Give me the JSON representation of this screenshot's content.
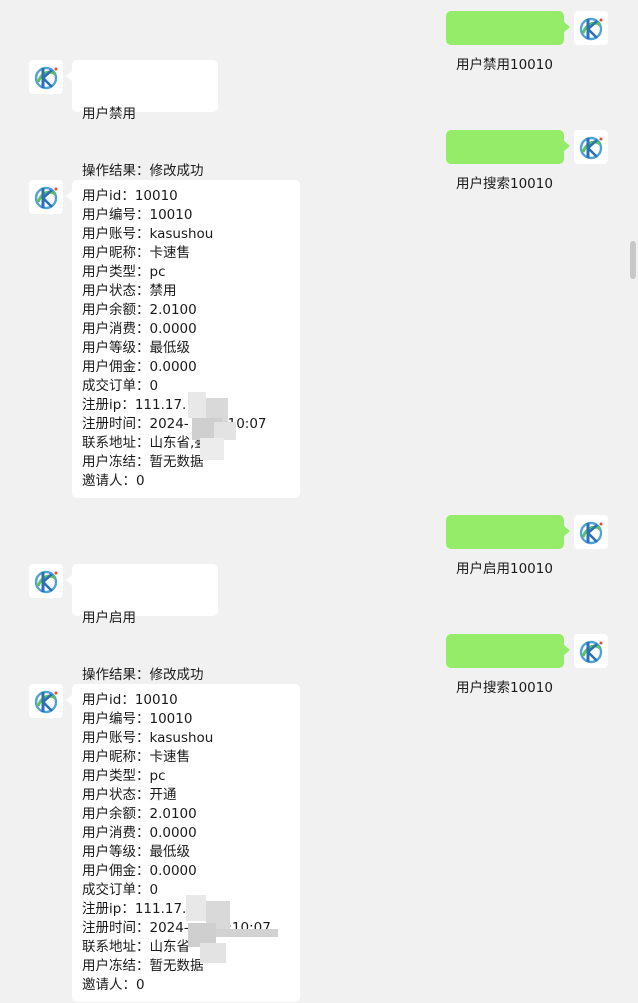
{
  "colors": {
    "background": "#f1f1f1",
    "sent_bubble": "#95ec69",
    "received_bubble": "#ffffff",
    "avatar_icon": "app-logo-icon"
  },
  "messages": [
    {
      "dir": "out",
      "lines": [
        "用户禁用10010"
      ]
    },
    {
      "dir": "in",
      "lines": [
        "用户禁用",
        "操作结果：修改成功"
      ]
    },
    {
      "dir": "out",
      "lines": [
        "用户搜索10010"
      ]
    },
    {
      "dir": "in",
      "lines": [
        "用户id：10010",
        "用户编号：10010",
        "用户账号：kasushou",
        "用户昵称：卡速售",
        "用户类型：pc",
        "用户状态：禁用",
        "用户余额：2.0100",
        "用户消费：0.0000",
        "用户等级：最低级",
        "用户佣金：0.0000",
        "成交订单：0",
        "注册ip：111.17.   .9",
        "注册时间：2024-      9:10:07",
        "联系地址：山东省,臺",
        "用户冻结：暂无数据",
        "邀请人：0"
      ]
    },
    {
      "dir": "out",
      "lines": [
        "用户启用10010"
      ]
    },
    {
      "dir": "in",
      "lines": [
        "用户启用",
        "操作结果：修改成功"
      ]
    },
    {
      "dir": "out",
      "lines": [
        "用户搜索10010"
      ]
    },
    {
      "dir": "in",
      "lines": [
        "用户id：10010",
        "用户编号：10010",
        "用户账号：kasushou",
        "用户昵称：卡速售",
        "用户类型：pc",
        "用户状态：开通",
        "用户余额：2.0100",
        "用户消费：0.0000",
        "用户等级：最低级",
        "用户佣金：0.0000",
        "成交订单：0",
        "注册ip：111.17.   .9",
        "注册时间：2024-     00:10:07",
        "联系地址：山东省",
        "用户冻结：暂无数据",
        "邀请人：0"
      ]
    }
  ]
}
